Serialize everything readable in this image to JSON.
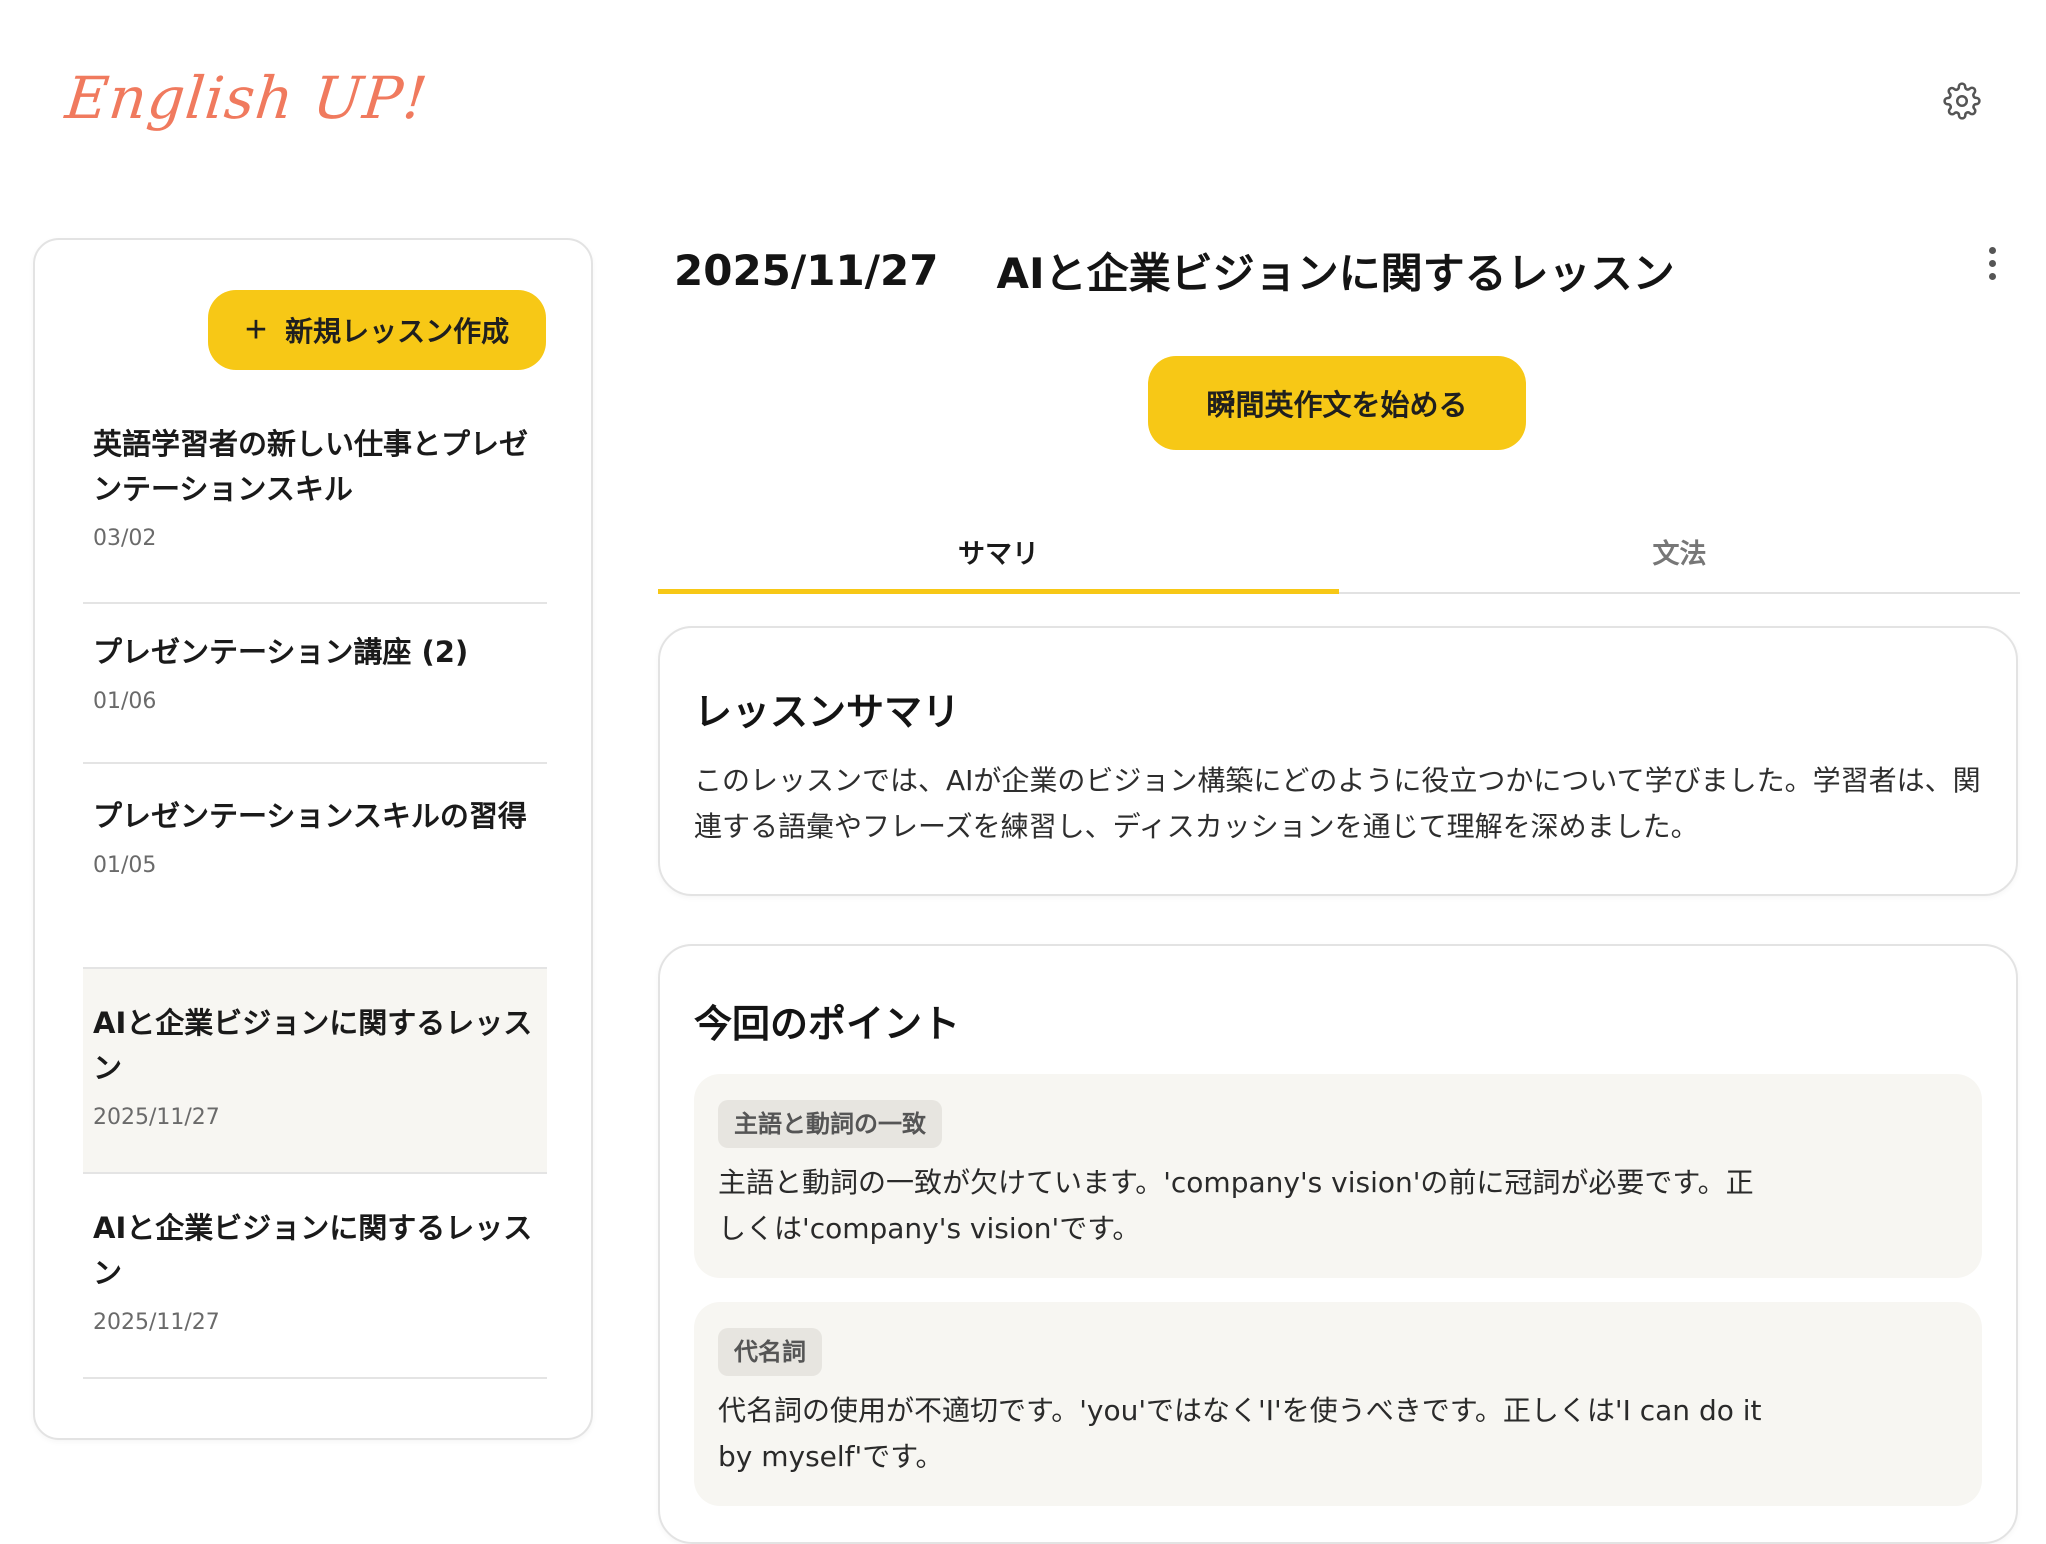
{
  "header": {
    "logo": "English UP!",
    "settings_icon": "gear-icon"
  },
  "sidebar": {
    "new_lesson_label": "新規レッスン作成",
    "lessons": [
      {
        "title": "英語学習者の新しい仕事とプレゼンテーションスキル",
        "date": "03/02"
      },
      {
        "title": "プレゼンテーション講座 (2)",
        "date": "01/06"
      },
      {
        "title": "プレゼンテーションスキルの習得",
        "date": "01/05"
      },
      {
        "title": "AIと企業ビジョンに関するレッスン",
        "date": "2025/11/27"
      },
      {
        "title": "AIと企業ビジョンに関するレッスン",
        "date": "2025/11/27"
      }
    ]
  },
  "main": {
    "date": "2025/11/27",
    "title": "AIと企業ビジョンに関するレッスン",
    "start_button": "瞬間英作文を始める",
    "tabs": [
      {
        "label": "サマリ"
      },
      {
        "label": "文法"
      }
    ],
    "summary": {
      "title": "レッスンサマリ",
      "text": "このレッスンでは、AIが企業のビジョン構築にどのように役立つかについて学びました。学習者は、関連する語彙やフレーズを練習し、ディスカッションを通じて理解を深めました。"
    },
    "points": {
      "title": "今回のポイント",
      "items": [
        {
          "tag": "主語と動詞の一致",
          "text": "主語と動詞の一致が欠けています。'company's vision'の前に冠詞が必要です。正しくは'company's vision'です。"
        },
        {
          "tag": "代名詞",
          "text": "代名詞の使用が不適切です。'you'ではなく'I'を使うべきです。正しくは'I can do it by myself'です。"
        }
      ]
    }
  }
}
